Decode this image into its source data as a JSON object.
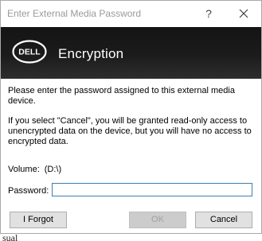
{
  "window": {
    "title": "Enter External Media Password",
    "help_label": "?",
    "close_icon": "close-icon"
  },
  "banner": {
    "brand": "DELL",
    "title": "Encryption",
    "logo_icon": "dell-logo"
  },
  "body": {
    "paragraph1": "Please enter the password assigned to this external media device.",
    "paragraph2": "If you select \"Cancel\", you will be granted read-only access to unencrypted data on the device, but you will have no access to encrypted data."
  },
  "volume": {
    "label": "Volume:",
    "value": "(D:\\)"
  },
  "password": {
    "label": "Password:",
    "value": ""
  },
  "buttons": {
    "forgot": "I Forgot",
    "ok": "OK",
    "cancel": "Cancel"
  },
  "background": {
    "partial_text": "sual"
  },
  "colors": {
    "banner": "#1b1b1b",
    "input_border": "#3c7fb1",
    "button_face": "#e1e1e1",
    "disabled_text": "#a0a0a0"
  }
}
